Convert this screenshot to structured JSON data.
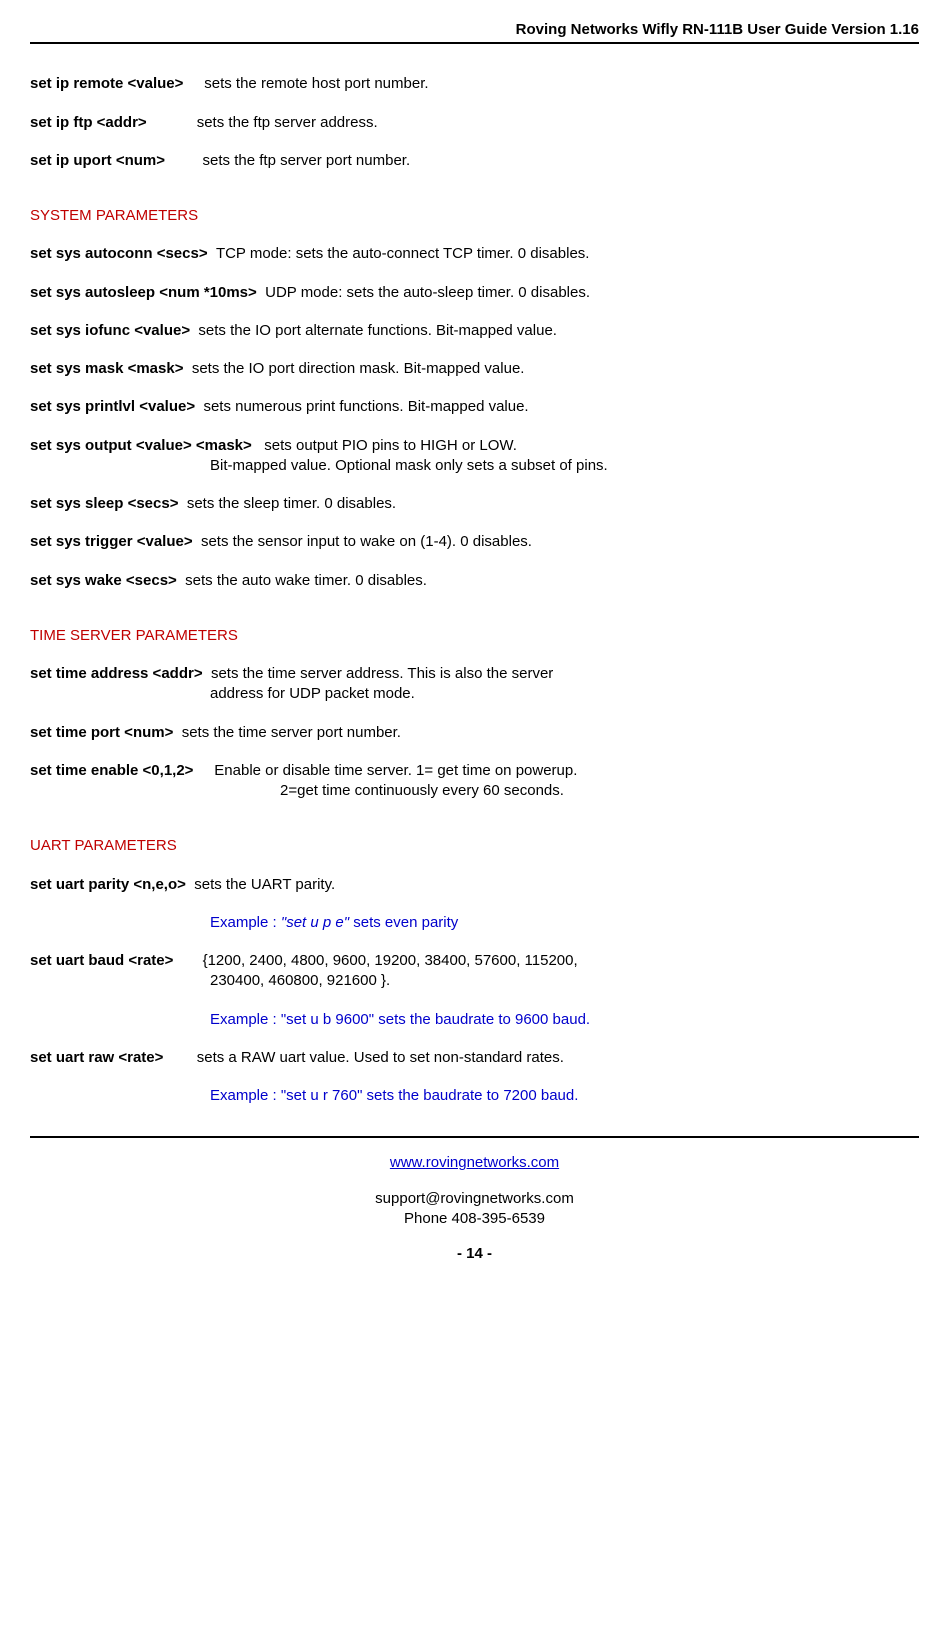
{
  "header": "Roving Networks Wifly  RN-111B User Guide  Version 1.16",
  "ip": {
    "remote_cmd": "set ip remote <value>",
    "remote_desc": "sets the remote host port number.",
    "ftp_cmd": "set ip ftp <addr>",
    "ftp_desc": "sets the ftp server address.",
    "uport_cmd": "set ip uport <num>",
    "uport_desc": "sets the ftp server port number."
  },
  "sections": {
    "system": "SYSTEM PARAMETERS",
    "time": "TIME SERVER PARAMETERS",
    "uart": "UART PARAMETERS"
  },
  "sys": {
    "autoconn_cmd": "set sys autoconn  <secs>",
    "autoconn_desc": "TCP mode: sets the auto-connect TCP timer.  0 disables.",
    "autosleep_cmd": "set sys autosleep  <num *10ms>",
    "autosleep_desc": "UDP mode: sets the auto-sleep timer.  0 disables.",
    "iofunc_cmd": "set sys iofunc    <value>",
    "iofunc_desc": "sets the IO port alternate functions. Bit-mapped value.",
    "mask_cmd": "set sys mask   <mask>",
    "mask_desc": "sets the IO port direction mask. Bit-mapped value.",
    "printlvl_cmd": "set sys printlvl  <value>",
    "printlvl_desc": "sets numerous print functions.  Bit-mapped value.",
    "output_cmd": "set sys output  <value> <mask>",
    "output_desc": "sets output PIO pins to HIGH or LOW.",
    "output_cont": "Bit-mapped value. Optional mask only sets a subset of pins.",
    "sleep_cmd": "set sys sleep   <secs>",
    "sleep_desc": "sets the sleep timer.  0 disables.",
    "trigger_cmd": "set sys trigger  <value>",
    "trigger_desc": "sets the sensor input to wake on (1-4).   0 disables.",
    "wake_cmd": "set sys wake   <secs>",
    "wake_desc": "sets the auto wake timer.  0 disables."
  },
  "time": {
    "address_cmd": "set time address  <addr>",
    "address_desc": "sets the time server address.  This is also the server",
    "address_cont": "address for UDP packet mode.",
    "port_cmd": "set time port  <num>",
    "port_desc": "sets the time server port number.",
    "enable_cmd": "set time enable <0,1,2>",
    "enable_desc": "Enable or disable time server. 1= get time on powerup.",
    "enable_cont": "2=get time continuously every 60 seconds."
  },
  "uart": {
    "parity_cmd": "set uart parity  <n,e,o>",
    "parity_desc": "sets the UART parity.",
    "parity_ex_prefix": "Example :  ",
    "parity_ex_quote": "\"set u p e\"",
    "parity_ex_suffix": "  sets even parity",
    "baud_cmd": "set uart baud <rate>",
    "baud_desc": "{1200, 2400, 4800, 9600, 19200, 38400, 57600, 115200,",
    "baud_cont": "230400, 460800, 921600 }.",
    "baud_ex": "Example :  \"set u b 9600\" sets the baudrate to 9600 baud.",
    "raw_cmd": "set uart raw <rate>",
    "raw_desc": "sets a RAW uart value.  Used to set non-standard rates.",
    "raw_ex": "Example :  \"set u r 760\" sets the baudrate to 7200 baud."
  },
  "footer": {
    "link": "www.rovingnetworks.com",
    "email": "support@rovingnetworks.com",
    "phone": "Phone 408-395-6539",
    "page": "- 14 -"
  }
}
